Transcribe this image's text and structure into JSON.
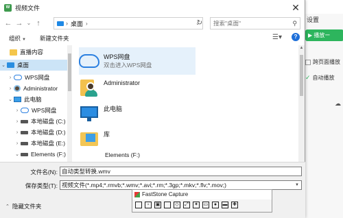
{
  "background_app": {
    "settings_label": "设置",
    "play_button": "▶ 播放ー",
    "option_cross_page": "跨页面播放",
    "option_auto_play": "自动播放"
  },
  "dialog": {
    "title": "视频文件",
    "close_glyph": "✕",
    "address": {
      "location": "桌面",
      "separator": "›",
      "search_placeholder": "搜索\"桌面\""
    },
    "toolbar": {
      "organize": "组织",
      "new_folder": "新建文件夹",
      "help_glyph": "?"
    },
    "nav_items": [
      {
        "label": "直播内容",
        "icon": "folder-icon"
      },
      {
        "label": "桌面",
        "icon": "desktop-icon"
      },
      {
        "label": "WPS网盘",
        "icon": "cloud-icon"
      },
      {
        "label": "Administrator",
        "icon": "user-icon"
      },
      {
        "label": "此电脑",
        "icon": "pc-icon"
      },
      {
        "label": "WPS网盘",
        "icon": "cloud-icon"
      },
      {
        "label": "本地磁盘 (C:)",
        "icon": "disk-icon"
      },
      {
        "label": "本地磁盘 (D:)",
        "icon": "disk-icon"
      },
      {
        "label": "本地磁盘 (E:)",
        "icon": "disk-icon"
      },
      {
        "label": "Elements (F:)",
        "icon": "disk-icon"
      }
    ],
    "files": [
      {
        "name": "WPS网盘",
        "sub": "双击进入WPS网盘",
        "icon": "cloud-icon"
      },
      {
        "name": "Administrator",
        "sub": "",
        "icon": "user-folder-icon"
      },
      {
        "name": "此电脑",
        "sub": "",
        "icon": "pc-icon"
      },
      {
        "name": "库",
        "sub": "",
        "icon": "library-icon"
      },
      {
        "name": "Elements (F:)",
        "sub": "",
        "icon": "disk-icon"
      }
    ],
    "filename_label": "文件名(N):",
    "filename_value": "自动类型转换.wmv",
    "savetype_label": "保存类型(T):",
    "savetype_value": "视频文件(*.mp4;*.rmvb;*.wmv;*.avi;*.rm;*.3gp;*.mkv;*.flv;*.mov;)",
    "hide_folders": "隐藏文件夹"
  },
  "faststone": {
    "title": "FastStone Capture"
  }
}
